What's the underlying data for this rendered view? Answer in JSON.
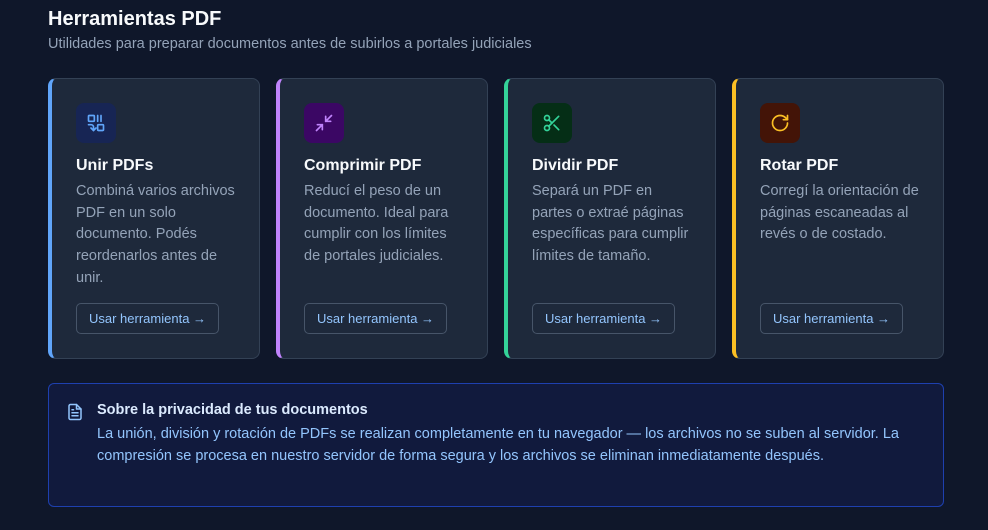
{
  "header": {
    "title": "Herramientas PDF",
    "subtitle": "Utilidades para preparar documentos antes de subirlos a portales judiciales"
  },
  "tools": [
    {
      "title": "Unir PDFs",
      "description": "Combiná varios archivos PDF en un solo documento. Podés reordenarlos antes de unir.",
      "button_label": "Usar herramienta →",
      "icon": "merge-icon",
      "accent": "#60a5fa"
    },
    {
      "title": "Comprimir PDF",
      "description": "Reducí el peso de un documento. Ideal para cumplir con los límites de portales judiciales.",
      "button_label": "Usar herramienta →",
      "icon": "compress-icon",
      "accent": "#c084fc"
    },
    {
      "title": "Dividir PDF",
      "description": "Separá un PDF en partes o extraé páginas específicas para cumplir límites de tamaño.",
      "button_label": "Usar herramienta →",
      "icon": "scissors-icon",
      "accent": "#34d399"
    },
    {
      "title": "Rotar PDF",
      "description": "Corregí la orientación de páginas escaneadas al revés o de costado.",
      "button_label": "Usar herramienta →",
      "icon": "rotate-icon",
      "accent": "#fbbf24"
    }
  ],
  "privacy_notice": {
    "icon": "document-icon",
    "title": "Sobre la privacidad de tus documentos",
    "text": "La unión, división y rotación de PDFs se realizan completamente en tu navegador — los archivos no se suben al servidor. La compresión se procesa en nuestro servidor de forma segura y los archivos se eliminan inmediatamente después."
  }
}
